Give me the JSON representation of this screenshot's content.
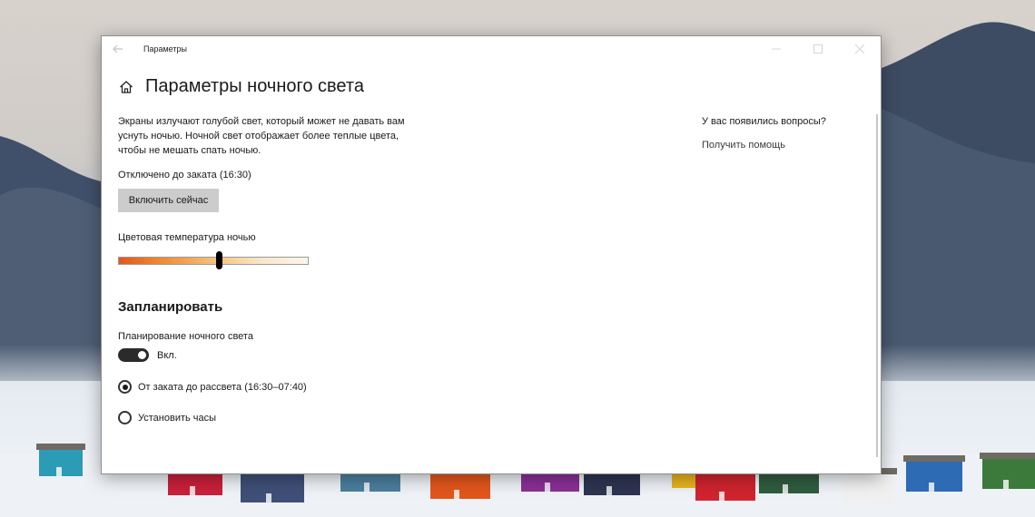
{
  "window": {
    "title": "Параметры"
  },
  "page": {
    "title": "Параметры ночного света",
    "description": "Экраны излучают голубой свет, который может не давать вам уснуть ночью. Ночной свет отображает более теплые цвета, чтобы не мешать спать ночью.",
    "status": "Отключено до заката (16:30)",
    "enable_now_label": "Включить сейчас",
    "color_temp_label": "Цветовая температура ночью",
    "color_temp_value": 0.53,
    "schedule_section_title": "Запланировать",
    "schedule_label": "Планирование ночного света",
    "schedule_toggle": {
      "on": true,
      "state_label": "Вкл."
    },
    "schedule_options": [
      {
        "label": "От заката до рассвета (16:30–07:40)",
        "selected": true
      },
      {
        "label": "Установить часы",
        "selected": false
      }
    ]
  },
  "side": {
    "question": "У вас появились вопросы?",
    "help_link": "Получить помощь"
  },
  "icons": {
    "back": "back-arrow-icon",
    "home": "home-icon",
    "minimize": "minimize-icon",
    "maximize": "maximize-icon",
    "close": "close-icon"
  }
}
